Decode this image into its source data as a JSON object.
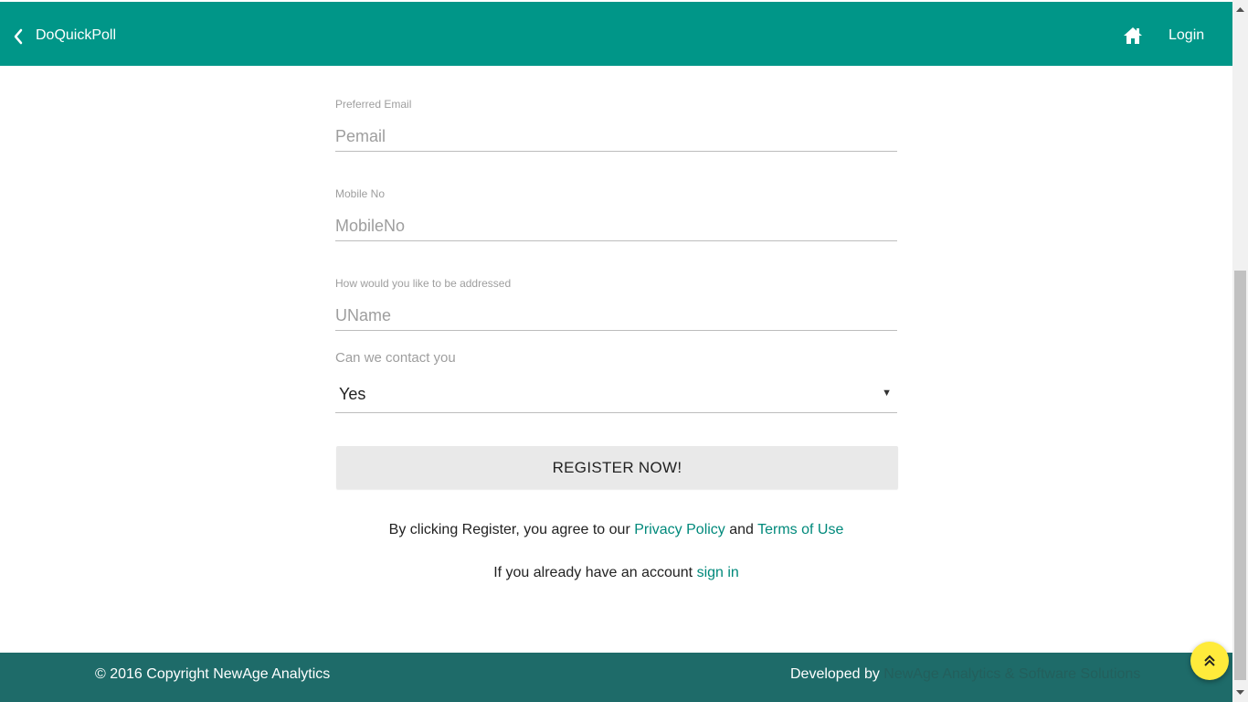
{
  "header": {
    "brand": "DoQuickPoll",
    "login": "Login",
    "color": "#009688"
  },
  "form": {
    "email": {
      "label": "Preferred Email",
      "placeholder": "Pemail"
    },
    "mobile": {
      "label": "Mobile No",
      "placeholder": "MobileNo"
    },
    "address": {
      "label": "How would you like to be addressed",
      "placeholder": "UName"
    },
    "contact": {
      "label": "Can we contact you",
      "value": "Yes"
    },
    "register": "REGISTER NOW!"
  },
  "terms": {
    "prefix": "By clicking Register, you agree to our ",
    "privacy": "Privacy Policy",
    "and": " and ",
    "tos": "Terms of Use"
  },
  "signin": {
    "prefix": "If you already have an account ",
    "link": "sign in"
  },
  "footer": {
    "copyright": "© 2016 Copyright NewAge Analytics",
    "developed_prefix": "Developed by ",
    "developer": "NewAge Analytics & Software Solutions",
    "color": "#1e6b69"
  },
  "icons": {
    "back": "chevron-left-icon",
    "home": "home-icon",
    "scroll_top": "double-chevron-up-icon"
  }
}
